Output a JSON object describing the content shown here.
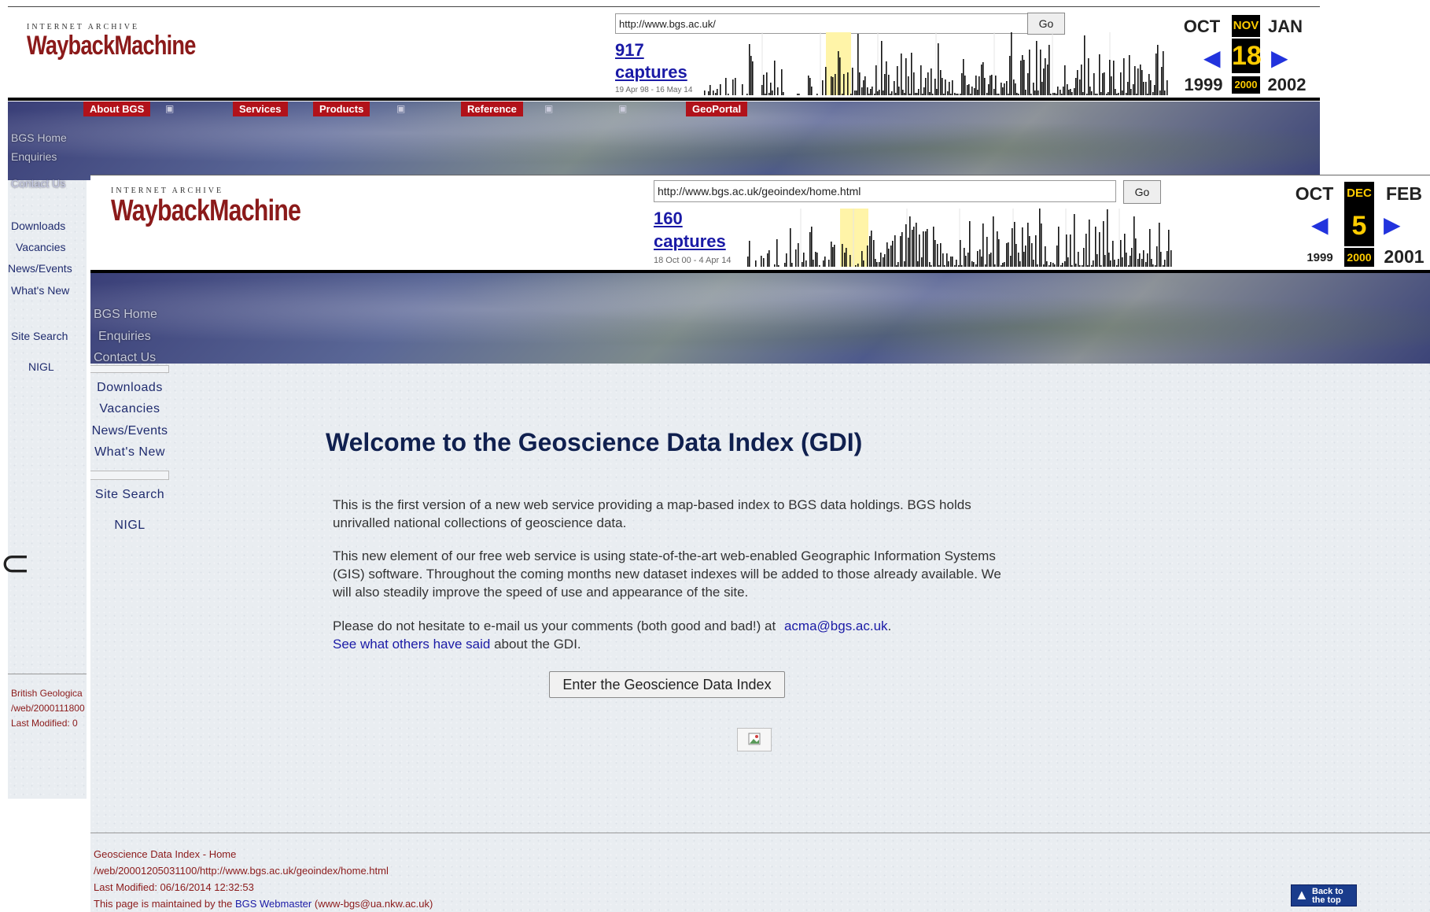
{
  "back_wayback": {
    "logo_top": "INTERNET ARCHIVE",
    "logo_main": "WaybackMachine",
    "url": "http://www.bgs.ac.uk/",
    "go": "Go",
    "captures_count": "917",
    "captures_word": "captures",
    "range": "19 Apr 98 - 16 May 14",
    "months": [
      "OCT",
      "NOV",
      "JAN"
    ],
    "day": "18",
    "years": [
      "1999",
      "2000",
      "2002"
    ]
  },
  "back_nav": [
    "About BGS",
    "Services",
    "Products",
    "Reference",
    "GeoPortal"
  ],
  "back_side_ghost": [
    "BGS Home",
    "Enquiries",
    "Contact Us"
  ],
  "back_side_links": [
    "Downloads",
    "Vacancies",
    "News/Events",
    "What's New",
    "Site Search",
    "NIGL"
  ],
  "back_footer": [
    "British Geologica",
    "/web/2000111800",
    "Last Modified: 0"
  ],
  "front_wayback": {
    "logo_top": "INTERNET ARCHIVE",
    "logo_main": "WaybackMachine",
    "url": "http://www.bgs.ac.uk/geoindex/home.html",
    "go": "Go",
    "captures_count": "160",
    "captures_word": "captures",
    "range": "18 Oct 00 - 4 Apr 14",
    "months": [
      "OCT",
      "DEC",
      "FEB"
    ],
    "day": "5",
    "years": [
      "1999",
      "2000",
      "2001"
    ]
  },
  "front_side_ghost": [
    "BGS Home",
    "Enquiries",
    "Contact Us"
  ],
  "front_side_links": [
    "Downloads",
    "Vacancies",
    "News/Events",
    "What's New",
    "Site Search",
    "NIGL"
  ],
  "main": {
    "title": "Welcome to the Geoscience Data Index (GDI)",
    "p1": "This is the first version of a new web service providing a map-based index to BGS data holdings. BGS holds unrivalled national collections of geoscience data.",
    "p2": "This new element of our free web service is using state-of-the-art web-enabled Geographic Information Systems (GIS) software. Throughout the coming months new dataset indexes will be added to those already available. We will also steadily improve the speed of use and appearance of the site.",
    "p3_before": "Please do not hesitate to e-mail us your comments (both good and bad!) at",
    "p3_email": "acma@bgs.ac.uk",
    "p3_after": ".",
    "p4_link": "See what others have said",
    "p4_after": "about the GDI.",
    "enter_button": "Enter the Geoscience Data Index"
  },
  "footer": {
    "line1": "Geoscience Data Index - Home",
    "line2": "/web/20001205031100/http://www.bgs.ac.uk/geoindex/home.html",
    "line3": "Last Modified: 06/16/2014 12:32:53",
    "line4_before": "This page is maintained by the",
    "line4_link": "BGS Webmaster",
    "line4_after": "(www-bgs@ua.nkw.ac.uk)",
    "back_to_top": "Back to the top"
  }
}
